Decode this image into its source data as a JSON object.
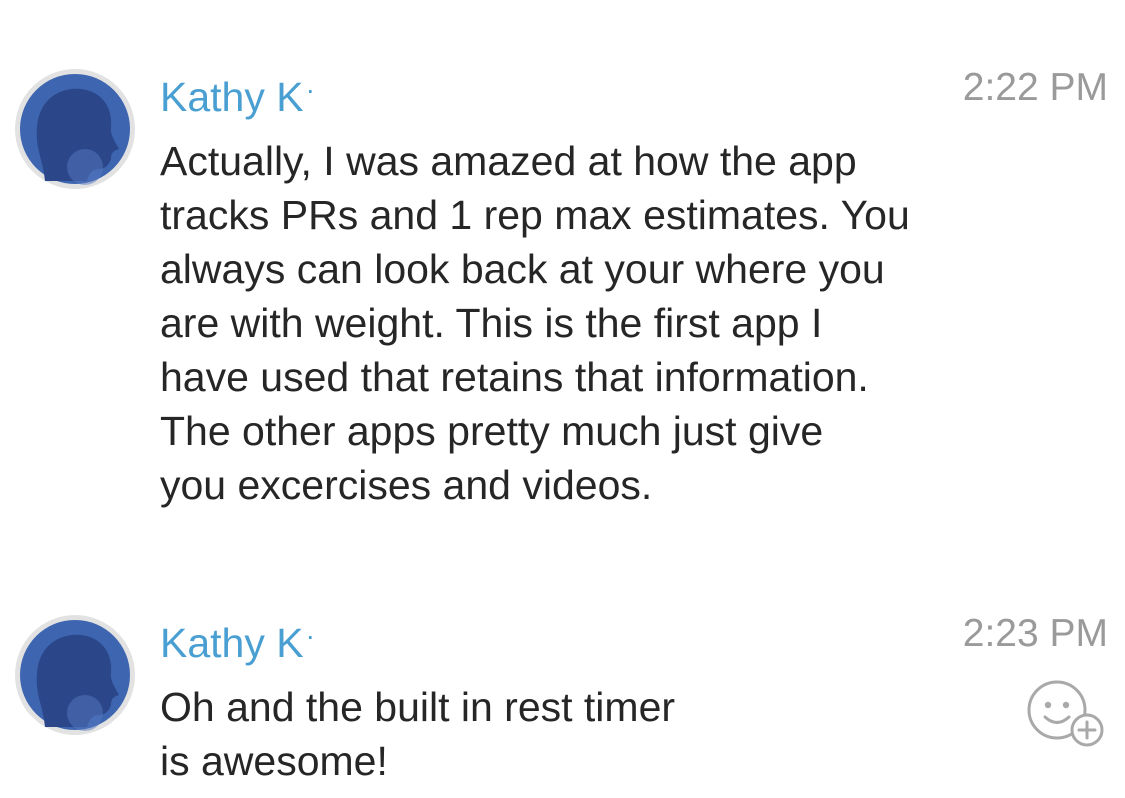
{
  "messages": [
    {
      "author": "Kathy K",
      "author_marker": "·",
      "time": "2:22 PM",
      "lines": [
        "Actually, I was amazed at how the app",
        "tracks PRs and 1 rep max estimates. You",
        "always can look back at your where you",
        "are with weight. This is the first app I",
        "have used that retains that information.",
        "The other apps pretty much just give",
        "you excercises and videos."
      ],
      "avatar_icon": "profile-avatar-icon"
    },
    {
      "author": "Kathy K",
      "author_marker": "·",
      "time": "2:23 PM",
      "lines": [
        "Oh and the built in rest timer",
        "is awesome!"
      ],
      "avatar_icon": "profile-avatar-icon",
      "reaction_icon": "add-reaction-icon"
    }
  ],
  "colors": {
    "author": "#4a9fd2",
    "time": "#9a9a9a",
    "text": "#262626",
    "avatar_bg": "#3e66b0"
  }
}
